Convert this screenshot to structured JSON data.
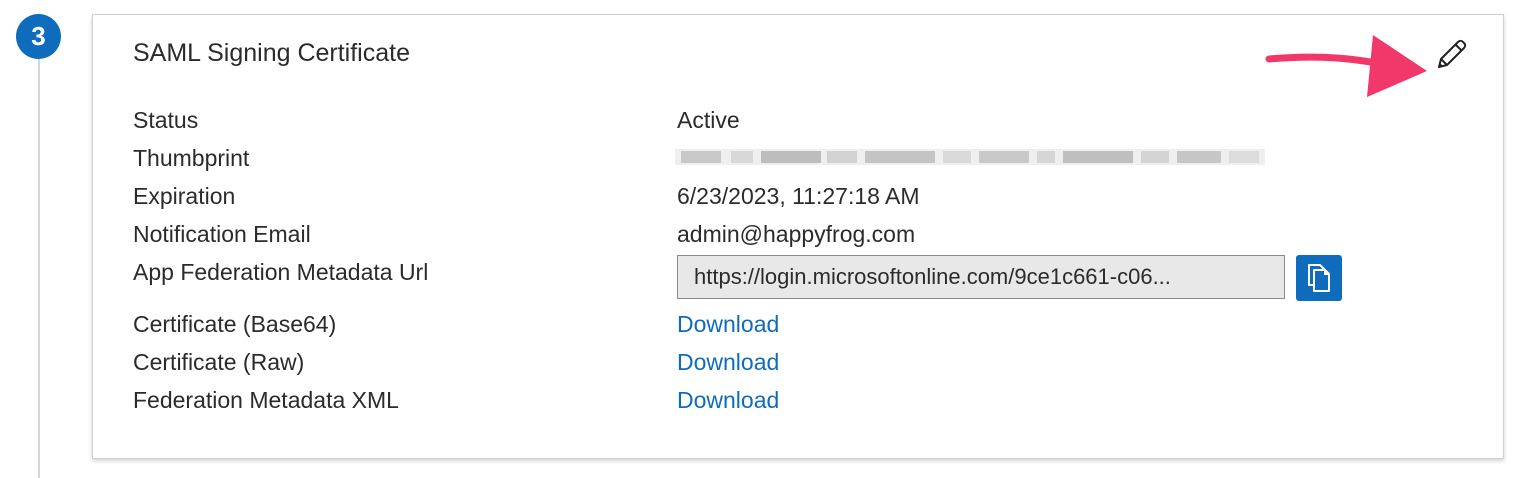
{
  "step": {
    "number": "3"
  },
  "card": {
    "title": "SAML Signing Certificate"
  },
  "rows": {
    "status": {
      "label": "Status",
      "value": "Active"
    },
    "thumbprint": {
      "label": "Thumbprint"
    },
    "expiration": {
      "label": "Expiration",
      "value": "6/23/2023, 11:27:18 AM"
    },
    "notification_email": {
      "label": "Notification Email",
      "value": "admin@happyfrog.com"
    },
    "metadata_url": {
      "label": "App Federation Metadata Url",
      "value": "https://login.microsoftonline.com/9ce1c661-c06..."
    },
    "cert_base64": {
      "label": "Certificate (Base64)",
      "link": "Download"
    },
    "cert_raw": {
      "label": "Certificate (Raw)",
      "link": "Download"
    },
    "federation_xml": {
      "label": "Federation Metadata XML",
      "link": "Download"
    }
  },
  "colors": {
    "accent": "#0f6cbd",
    "annotation_arrow": "#f2386b"
  },
  "icons": {
    "edit": "pencil-icon",
    "copy": "copy-icon",
    "annotation": "arrow-icon"
  }
}
